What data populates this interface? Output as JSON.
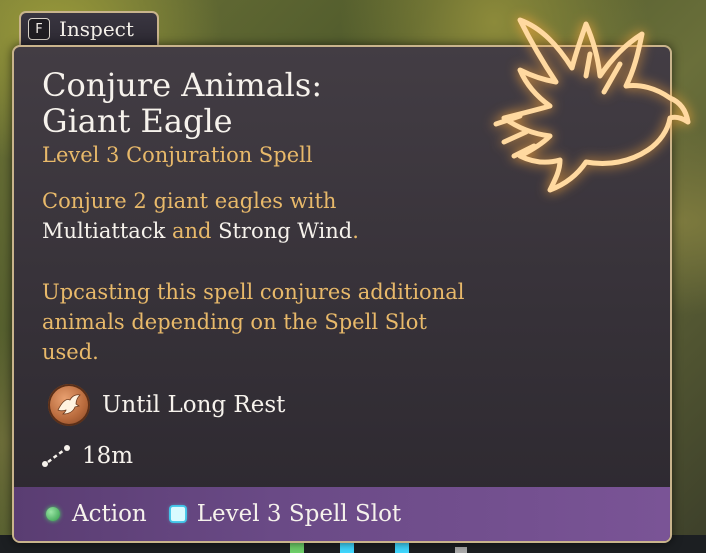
{
  "inspect": {
    "key": "F",
    "label": "Inspect"
  },
  "spell": {
    "title_line1": "Conjure Animals:",
    "title_line2": "Giant Eagle",
    "subtitle": "Level 3 Conjuration Spell",
    "desc_part1": "Conjure 2 giant eagles with",
    "desc_hl1": "Multiattack",
    "desc_and": " and ",
    "desc_hl2": "Strong Wind",
    "desc_end": ".",
    "upcast": "Upcasting this spell conjures additional animals depending on the Spell Slot used.",
    "duration": "Until Long Rest",
    "range": "18m",
    "icon": "eagle-glyph-icon"
  },
  "cost": {
    "action_label": "Action",
    "slot_label": "Level 3 Spell Slot"
  },
  "colors": {
    "accent_text": "#e8b96a",
    "border": "#c9b48c",
    "footer": "#6a4a86"
  }
}
